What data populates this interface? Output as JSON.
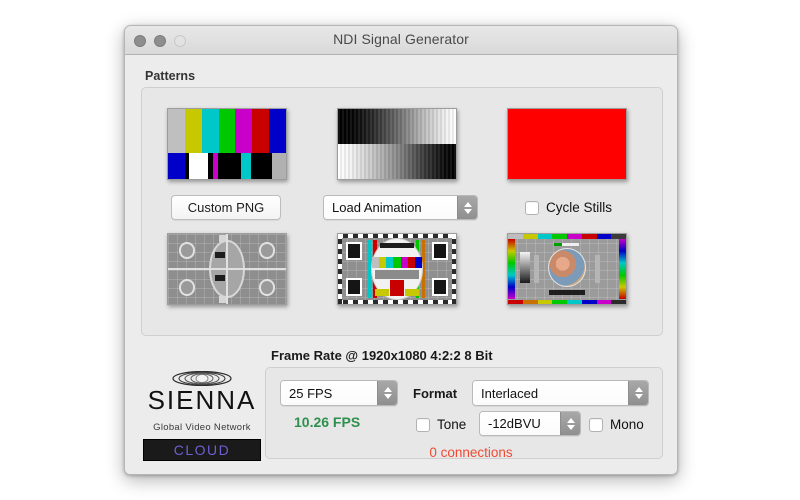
{
  "window": {
    "title": "NDI Signal Generator",
    "traffic_lights": [
      "close-button",
      "minimize-button",
      "zoom-button"
    ]
  },
  "patterns": {
    "group_label": "Patterns",
    "thumbnails_row1": [
      {
        "name": "smpte-color-bars",
        "kind": "color-bars",
        "top_colors": [
          "#bfbfbf",
          "#c8c800",
          "#00c8c8",
          "#00c800",
          "#c800c8",
          "#c80000",
          "#0000c8"
        ],
        "bottom_colors": [
          "#0000c8",
          "#000000",
          "#ffffff",
          "#c800c8",
          "#000000",
          "#00c8c8",
          "#000000",
          "#b0b0b0"
        ]
      },
      {
        "name": "grayscale-ramp",
        "kind": "gray-ramp"
      },
      {
        "name": "flat-red-field",
        "kind": "flat",
        "color": "#ff0000"
      }
    ],
    "thumbnails_row2": [
      {
        "name": "mono-test-card",
        "kind": "testcard-mono"
      },
      {
        "name": "color-test-card",
        "kind": "testcard-color"
      },
      {
        "name": "photo-test-card",
        "kind": "testcard-photo"
      }
    ],
    "custom_png_button": "Custom PNG",
    "load_animation_value": "Load Animation",
    "cycle_stills_label": "Cycle Stills",
    "cycle_stills_checked": false
  },
  "framerate": {
    "header": "Frame Rate @ 1920x1080 4:2:2 8 Bit",
    "fps_value": "25 FPS",
    "format_label": "Format",
    "format_value": "Interlaced",
    "live_fps": "10.26 FPS",
    "tone_label": "Tone",
    "tone_checked": false,
    "tone_level_value": "-12dBVU",
    "mono_label": "Mono",
    "mono_checked": false,
    "connections": "0 connections"
  },
  "branding": {
    "wordmark": "SIENNA",
    "tagline": "Global Video Network",
    "cloud_label": "CLOUD"
  },
  "colors": {
    "live_fps": "#2f8f4e",
    "connections": "#ef4a33",
    "cloud_text": "#6d5fd4",
    "red_field": "#ff0000"
  }
}
